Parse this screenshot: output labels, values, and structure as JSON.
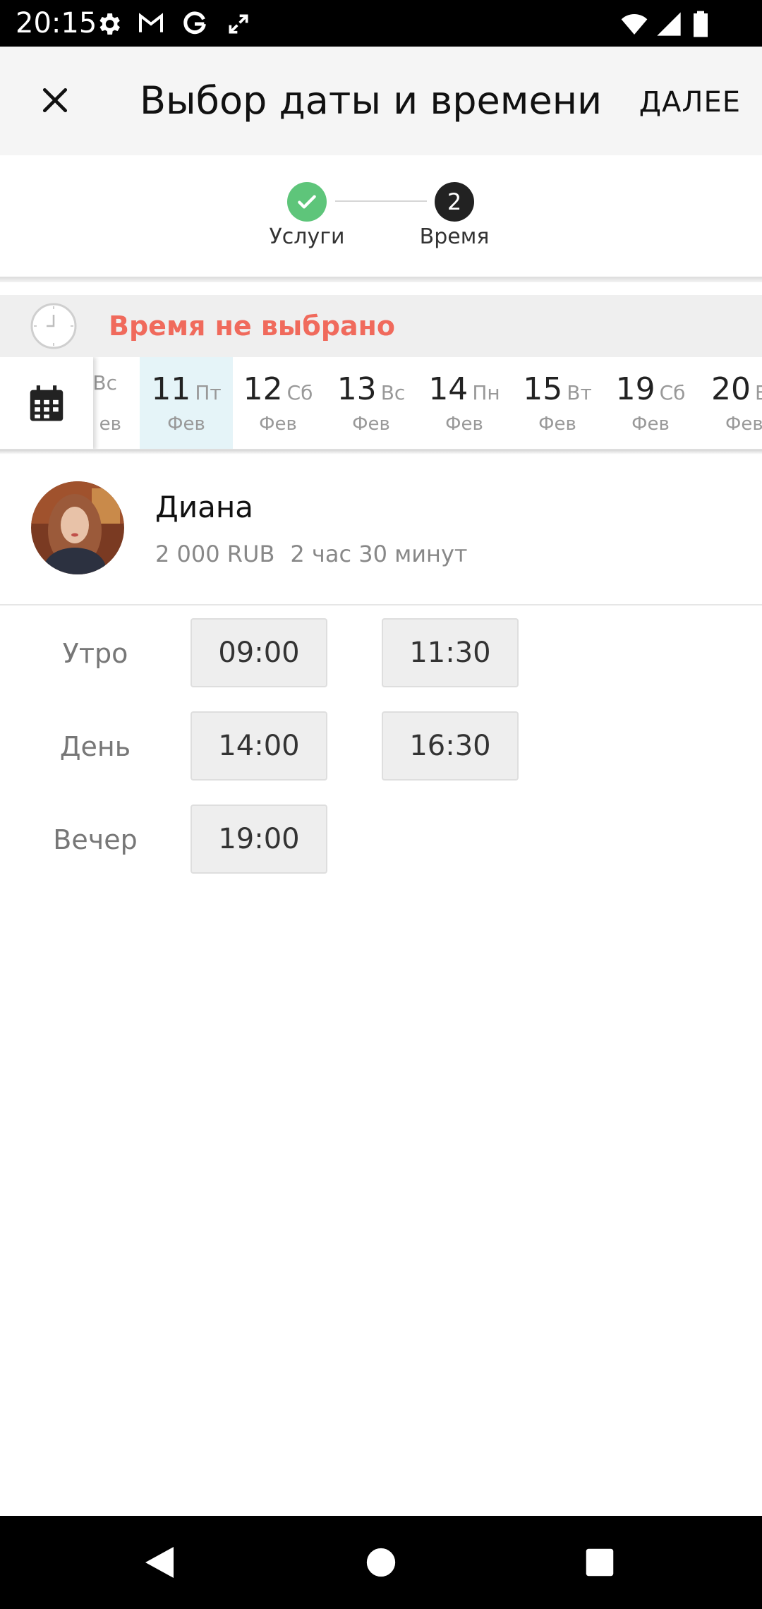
{
  "status_bar": {
    "time": "20:15",
    "icons": [
      "settings-icon",
      "gmail-icon",
      "google-icon",
      "expand-icon",
      "wifi-icon",
      "signal-icon",
      "battery-icon"
    ]
  },
  "app_bar": {
    "title": "Выбор даты и времени",
    "next_label": "ДАЛЕЕ",
    "close_icon": "close-icon"
  },
  "stepper": {
    "steps": [
      {
        "label": "Услуги",
        "state": "done",
        "number": ""
      },
      {
        "label": "Время",
        "state": "active",
        "number": "2"
      }
    ]
  },
  "time_status": {
    "text": "Время не выбрано",
    "color": "#f06a5c"
  },
  "dates": {
    "selected_index": 1,
    "items": [
      {
        "day": "",
        "dow": "Вс",
        "month": "ев"
      },
      {
        "day": "11",
        "dow": "Пт",
        "month": "Фев"
      },
      {
        "day": "12",
        "dow": "Сб",
        "month": "Фев"
      },
      {
        "day": "13",
        "dow": "Вс",
        "month": "Фев"
      },
      {
        "day": "14",
        "dow": "Пн",
        "month": "Фев"
      },
      {
        "day": "15",
        "dow": "Вт",
        "month": "Фев"
      },
      {
        "day": "19",
        "dow": "Сб",
        "month": "Фев"
      },
      {
        "day": "20",
        "dow": "В",
        "month": "Фев"
      }
    ]
  },
  "master": {
    "name": "Диана",
    "price": "2 000 RUB",
    "duration": "2 час 30 минут"
  },
  "slots": {
    "periods": [
      {
        "label": "Утро",
        "times": [
          "09:00",
          "11:30"
        ]
      },
      {
        "label": "День",
        "times": [
          "14:00",
          "16:30"
        ]
      },
      {
        "label": "Вечер",
        "times": [
          "19:00"
        ]
      }
    ]
  },
  "colors": {
    "done": "#5ec57a",
    "active": "#222222",
    "selected_date_bg": "#e5f4f8"
  }
}
